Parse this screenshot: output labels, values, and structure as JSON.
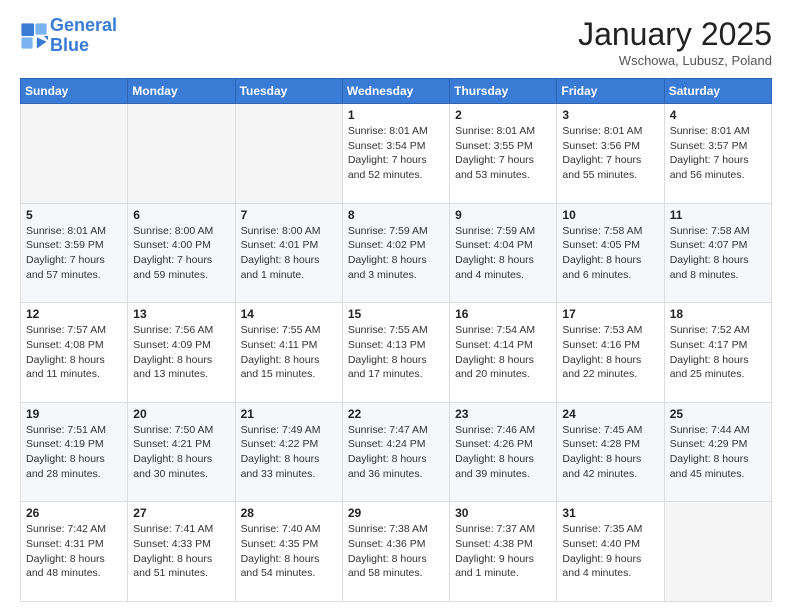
{
  "header": {
    "logo_line1": "General",
    "logo_line2": "Blue",
    "title": "January 2025",
    "location": "Wschowa, Lubusz, Poland"
  },
  "calendar": {
    "days_of_week": [
      "Sunday",
      "Monday",
      "Tuesday",
      "Wednesday",
      "Thursday",
      "Friday",
      "Saturday"
    ],
    "weeks": [
      [
        {
          "day": "",
          "info": ""
        },
        {
          "day": "",
          "info": ""
        },
        {
          "day": "",
          "info": ""
        },
        {
          "day": "1",
          "info": "Sunrise: 8:01 AM\nSunset: 3:54 PM\nDaylight: 7 hours\nand 52 minutes."
        },
        {
          "day": "2",
          "info": "Sunrise: 8:01 AM\nSunset: 3:55 PM\nDaylight: 7 hours\nand 53 minutes."
        },
        {
          "day": "3",
          "info": "Sunrise: 8:01 AM\nSunset: 3:56 PM\nDaylight: 7 hours\nand 55 minutes."
        },
        {
          "day": "4",
          "info": "Sunrise: 8:01 AM\nSunset: 3:57 PM\nDaylight: 7 hours\nand 56 minutes."
        }
      ],
      [
        {
          "day": "5",
          "info": "Sunrise: 8:01 AM\nSunset: 3:59 PM\nDaylight: 7 hours\nand 57 minutes."
        },
        {
          "day": "6",
          "info": "Sunrise: 8:00 AM\nSunset: 4:00 PM\nDaylight: 7 hours\nand 59 minutes."
        },
        {
          "day": "7",
          "info": "Sunrise: 8:00 AM\nSunset: 4:01 PM\nDaylight: 8 hours\nand 1 minute."
        },
        {
          "day": "8",
          "info": "Sunrise: 7:59 AM\nSunset: 4:02 PM\nDaylight: 8 hours\nand 3 minutes."
        },
        {
          "day": "9",
          "info": "Sunrise: 7:59 AM\nSunset: 4:04 PM\nDaylight: 8 hours\nand 4 minutes."
        },
        {
          "day": "10",
          "info": "Sunrise: 7:58 AM\nSunset: 4:05 PM\nDaylight: 8 hours\nand 6 minutes."
        },
        {
          "day": "11",
          "info": "Sunrise: 7:58 AM\nSunset: 4:07 PM\nDaylight: 8 hours\nand 8 minutes."
        }
      ],
      [
        {
          "day": "12",
          "info": "Sunrise: 7:57 AM\nSunset: 4:08 PM\nDaylight: 8 hours\nand 11 minutes."
        },
        {
          "day": "13",
          "info": "Sunrise: 7:56 AM\nSunset: 4:09 PM\nDaylight: 8 hours\nand 13 minutes."
        },
        {
          "day": "14",
          "info": "Sunrise: 7:55 AM\nSunset: 4:11 PM\nDaylight: 8 hours\nand 15 minutes."
        },
        {
          "day": "15",
          "info": "Sunrise: 7:55 AM\nSunset: 4:13 PM\nDaylight: 8 hours\nand 17 minutes."
        },
        {
          "day": "16",
          "info": "Sunrise: 7:54 AM\nSunset: 4:14 PM\nDaylight: 8 hours\nand 20 minutes."
        },
        {
          "day": "17",
          "info": "Sunrise: 7:53 AM\nSunset: 4:16 PM\nDaylight: 8 hours\nand 22 minutes."
        },
        {
          "day": "18",
          "info": "Sunrise: 7:52 AM\nSunset: 4:17 PM\nDaylight: 8 hours\nand 25 minutes."
        }
      ],
      [
        {
          "day": "19",
          "info": "Sunrise: 7:51 AM\nSunset: 4:19 PM\nDaylight: 8 hours\nand 28 minutes."
        },
        {
          "day": "20",
          "info": "Sunrise: 7:50 AM\nSunset: 4:21 PM\nDaylight: 8 hours\nand 30 minutes."
        },
        {
          "day": "21",
          "info": "Sunrise: 7:49 AM\nSunset: 4:22 PM\nDaylight: 8 hours\nand 33 minutes."
        },
        {
          "day": "22",
          "info": "Sunrise: 7:47 AM\nSunset: 4:24 PM\nDaylight: 8 hours\nand 36 minutes."
        },
        {
          "day": "23",
          "info": "Sunrise: 7:46 AM\nSunset: 4:26 PM\nDaylight: 8 hours\nand 39 minutes."
        },
        {
          "day": "24",
          "info": "Sunrise: 7:45 AM\nSunset: 4:28 PM\nDaylight: 8 hours\nand 42 minutes."
        },
        {
          "day": "25",
          "info": "Sunrise: 7:44 AM\nSunset: 4:29 PM\nDaylight: 8 hours\nand 45 minutes."
        }
      ],
      [
        {
          "day": "26",
          "info": "Sunrise: 7:42 AM\nSunset: 4:31 PM\nDaylight: 8 hours\nand 48 minutes."
        },
        {
          "day": "27",
          "info": "Sunrise: 7:41 AM\nSunset: 4:33 PM\nDaylight: 8 hours\nand 51 minutes."
        },
        {
          "day": "28",
          "info": "Sunrise: 7:40 AM\nSunset: 4:35 PM\nDaylight: 8 hours\nand 54 minutes."
        },
        {
          "day": "29",
          "info": "Sunrise: 7:38 AM\nSunset: 4:36 PM\nDaylight: 8 hours\nand 58 minutes."
        },
        {
          "day": "30",
          "info": "Sunrise: 7:37 AM\nSunset: 4:38 PM\nDaylight: 9 hours\nand 1 minute."
        },
        {
          "day": "31",
          "info": "Sunrise: 7:35 AM\nSunset: 4:40 PM\nDaylight: 9 hours\nand 4 minutes."
        },
        {
          "day": "",
          "info": ""
        }
      ]
    ]
  }
}
